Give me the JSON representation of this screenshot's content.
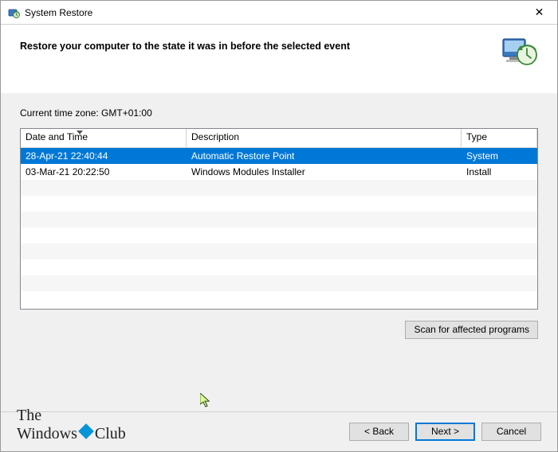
{
  "titlebar": {
    "title": "System Restore"
  },
  "header": {
    "text": "Restore your computer to the state it was in before the selected event"
  },
  "tz_label": "Current time zone: GMT+01:00",
  "columns": {
    "date": "Date and Time",
    "desc": "Description",
    "type": "Type"
  },
  "rows": [
    {
      "date": "28-Apr-21 22:40:44",
      "desc": "Automatic Restore Point",
      "type": "System",
      "selected": true
    },
    {
      "date": "03-Mar-21 20:22:50",
      "desc": "Windows Modules Installer",
      "type": "Install",
      "selected": false
    }
  ],
  "buttons": {
    "scan": "Scan for affected programs",
    "back": "< Back",
    "next": "Next >",
    "cancel": "Cancel"
  },
  "watermark": {
    "line1": "The",
    "line2_a": "Windows",
    "line2_b": "Club"
  }
}
